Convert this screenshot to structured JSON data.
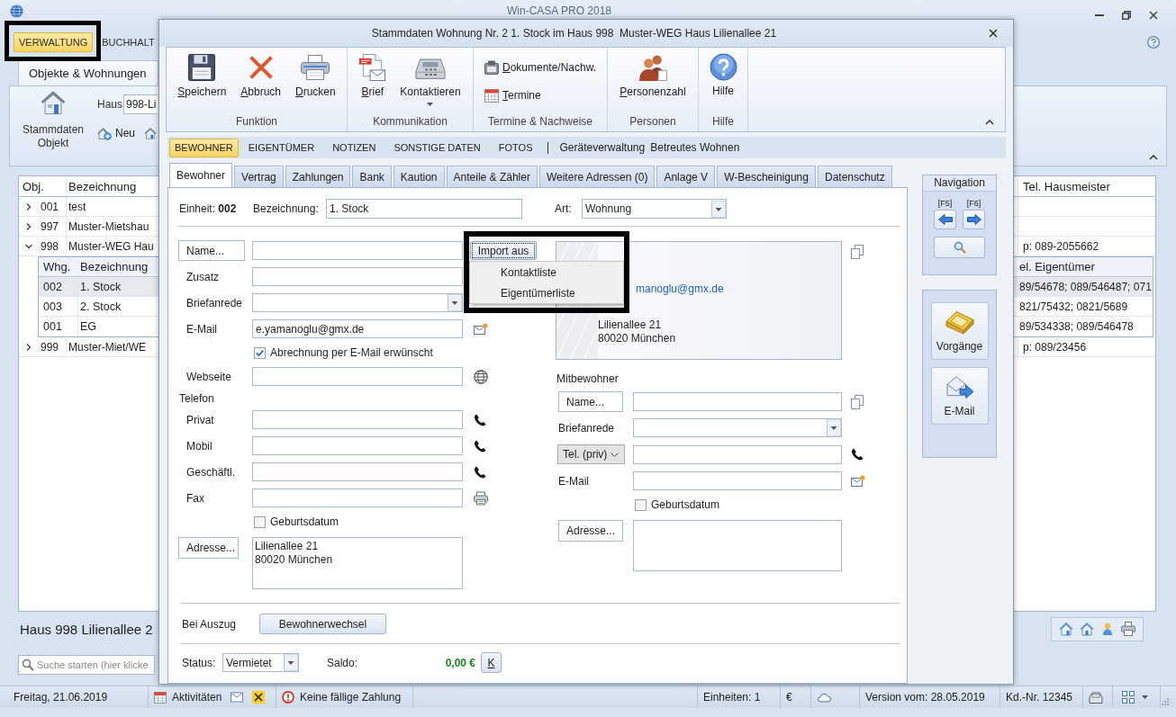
{
  "app": {
    "title": "Win-CASA PRO 2018"
  },
  "main_tabs": [
    {
      "label": "VERWALTUNG",
      "selected": true,
      "highlighted": true
    },
    {
      "label": "BUCHHALT",
      "selected": false,
      "highlighted": false
    }
  ],
  "ribbon": {
    "tab": "Objekte & Wohnungen",
    "master_data_button": "Stammdaten Objekt",
    "house_label": "Haus",
    "house_value": "998-Li",
    "new_button": "Neu"
  },
  "objects_table": {
    "columns": [
      "Obj.",
      "Bezeichnung",
      "Tel. Hausmeister"
    ],
    "unit_columns": [
      "Whg.",
      "Bezeichnung",
      "el. Eigentümer"
    ],
    "rows": [
      {
        "obj": "001",
        "name": "test",
        "expanded": false
      },
      {
        "obj": "997",
        "name": "Muster-Mietshau",
        "expanded": false
      },
      {
        "obj": "998",
        "name": "Muster-WEG Hau",
        "phone": "p: 089-2055662",
        "expanded": true,
        "children": [
          {
            "whg": "002",
            "name": "1. Stock",
            "phone": "89/54678; 089/546487; 071",
            "selected": true
          },
          {
            "whg": "003",
            "name": "2. Stock",
            "phone": "821/75432; 0821/5689",
            "selected": false
          },
          {
            "whg": "001",
            "name": "EG",
            "phone": "89/534338; 089/546478",
            "selected": false
          }
        ]
      },
      {
        "obj": "999",
        "name": "Muster-Miet/WE",
        "phone": "p: 089/23456",
        "expanded": false
      }
    ]
  },
  "house_caption": "Haus 998 Lilienallee 2",
  "search": {
    "placeholder": "Suche starten (hier klicke"
  },
  "status_bar": {
    "date": "Freitag, 21.06.2019",
    "activities": "Aktivitäten",
    "payments": "Keine fällige Zahlung",
    "units": "Einheiten: 1",
    "currency": "€",
    "version": "Version vom: 28.05.2019",
    "customer_no": "Kd.-Nr. 12345"
  },
  "dialog": {
    "title": "Stammdaten Wohnung Nr. 2 1. Stock im Haus 998  Muster-WEG Haus Lilienallee 21",
    "ribbon_groups": [
      {
        "label": "Funktion",
        "buttons": [
          {
            "kind": "save",
            "label": "Speichern",
            "mnemonic": true,
            "has_menu": false
          },
          {
            "kind": "cancel",
            "label": "Abbruch",
            "mnemonic": true,
            "has_menu": false
          },
          {
            "kind": "print",
            "label": "Drucken",
            "mnemonic": true,
            "has_menu": false
          }
        ]
      },
      {
        "label": "Kommunikation",
        "buttons": [
          {
            "kind": "letter",
            "label": "Brief",
            "mnemonic": true,
            "has_menu": false
          },
          {
            "kind": "contact",
            "label": "Kontaktieren",
            "mnemonic": false,
            "has_menu": true
          }
        ]
      },
      {
        "label": "Termine & Nachweise",
        "buttons": [
          {
            "kind": "documents",
            "label": "Dokumente/Nachw.",
            "mnemonic": true,
            "has_menu": false
          },
          {
            "kind": "appointments",
            "label": "Termine",
            "mnemonic": true,
            "has_menu": false
          }
        ]
      },
      {
        "label": "Personen",
        "buttons": [
          {
            "kind": "persons",
            "label": "Personenzahl",
            "mnemonic": true,
            "has_menu": false
          }
        ]
      },
      {
        "label": "Hilfe",
        "buttons": [
          {
            "kind": "help",
            "label": "Hilfe",
            "mnemonic": false,
            "has_menu": false
          }
        ]
      }
    ],
    "section_tabs": [
      {
        "label": "BEWOHNER",
        "selected": true
      },
      {
        "label": "EIGENTÜMER",
        "selected": false
      },
      {
        "label": "NOTIZEN",
        "selected": false
      },
      {
        "label": "SONSTIGE DATEN",
        "selected": false
      },
      {
        "label": "FOTOS",
        "selected": false
      }
    ],
    "section_links": [
      "Geräteverwaltung",
      "Betreutes Wohnen"
    ],
    "page_tabs": [
      {
        "label": "Bewohner",
        "selected": true
      },
      {
        "label": "Vertrag",
        "selected": false
      },
      {
        "label": "Zahlungen",
        "selected": false
      },
      {
        "label": "Bank",
        "selected": false
      },
      {
        "label": "Kaution",
        "selected": false
      },
      {
        "label": "Anteile & Zähler",
        "selected": false
      },
      {
        "label": "Weitere Adressen (0)",
        "selected": false
      },
      {
        "label": "Anlage V",
        "selected": false
      },
      {
        "label": "W-Bescheinigung",
        "selected": false
      },
      {
        "label": "Datenschutz",
        "selected": false
      }
    ],
    "unit_label": "Einheit: **002**",
    "designation_label": "Bezeichnung:",
    "designation_value": "1. Stock",
    "type_label": "Art:",
    "type_value": "Wohnung",
    "tenant_fields": [
      {
        "kind": "name",
        "label": "Name..."
      },
      {
        "kind": "text",
        "label": "Zusatz"
      },
      {
        "kind": "select",
        "label": "Briefanrede"
      },
      {
        "kind": "email",
        "label": "E-Mail",
        "value": "e.yamanoglu@gmx.de"
      },
      {
        "kind": "checkbox",
        "label": "Abrechnung per E-Mail erwünscht",
        "checked": true
      },
      {
        "kind": "web",
        "label": "Webseite"
      },
      {
        "kind": "heading",
        "label": "Telefon"
      },
      {
        "kind": "phone",
        "label": "Privat"
      },
      {
        "kind": "phone",
        "label": "Mobil"
      },
      {
        "kind": "phone",
        "label": "Geschäftl."
      },
      {
        "kind": "fax",
        "label": "Fax"
      },
      {
        "kind": "checkbox",
        "label": "Geburtsdatum",
        "checked": false
      },
      {
        "kind": "address",
        "label": "Adresse...",
        "lines": [
          "Lilienallee 21",
          "80020 München"
        ]
      }
    ],
    "import": {
      "label": "Import aus",
      "expanded": true,
      "highlighted": true,
      "items": [
        "Kontaktliste",
        "Eigentümerliste"
      ]
    },
    "card": {
      "email": "manoglu@gmx.de",
      "lines": [
        "Lilienallee 21",
        "80020 München"
      ]
    },
    "co_tenant_heading": "Mitbewohner",
    "co_tenant_fields": [
      {
        "kind": "name",
        "label": "Name..."
      },
      {
        "kind": "select",
        "label": "Briefanrede"
      },
      {
        "kind": "phone-select",
        "label": "Tel. (priv)"
      },
      {
        "kind": "email",
        "label": "E-Mail"
      },
      {
        "kind": "checkbox",
        "label": "Geburtsdatum",
        "checked": false
      },
      {
        "kind": "address",
        "label": "Adresse..."
      }
    ],
    "move_out_label": "Bei Auszug",
    "move_out_button": "Bewohnerwechsel",
    "status_label": "Status:",
    "status_value": "Vermietet",
    "balance_label": "Saldo:",
    "balance_value": "0,00 €",
    "account_button": "K",
    "navigation": {
      "title": "Navigation",
      "keys": [
        "[F5]",
        "[F6]"
      ]
    },
    "actions": [
      {
        "kind": "processes",
        "label": "Vorgänge"
      },
      {
        "kind": "email",
        "label": "E-Mail"
      }
    ]
  }
}
